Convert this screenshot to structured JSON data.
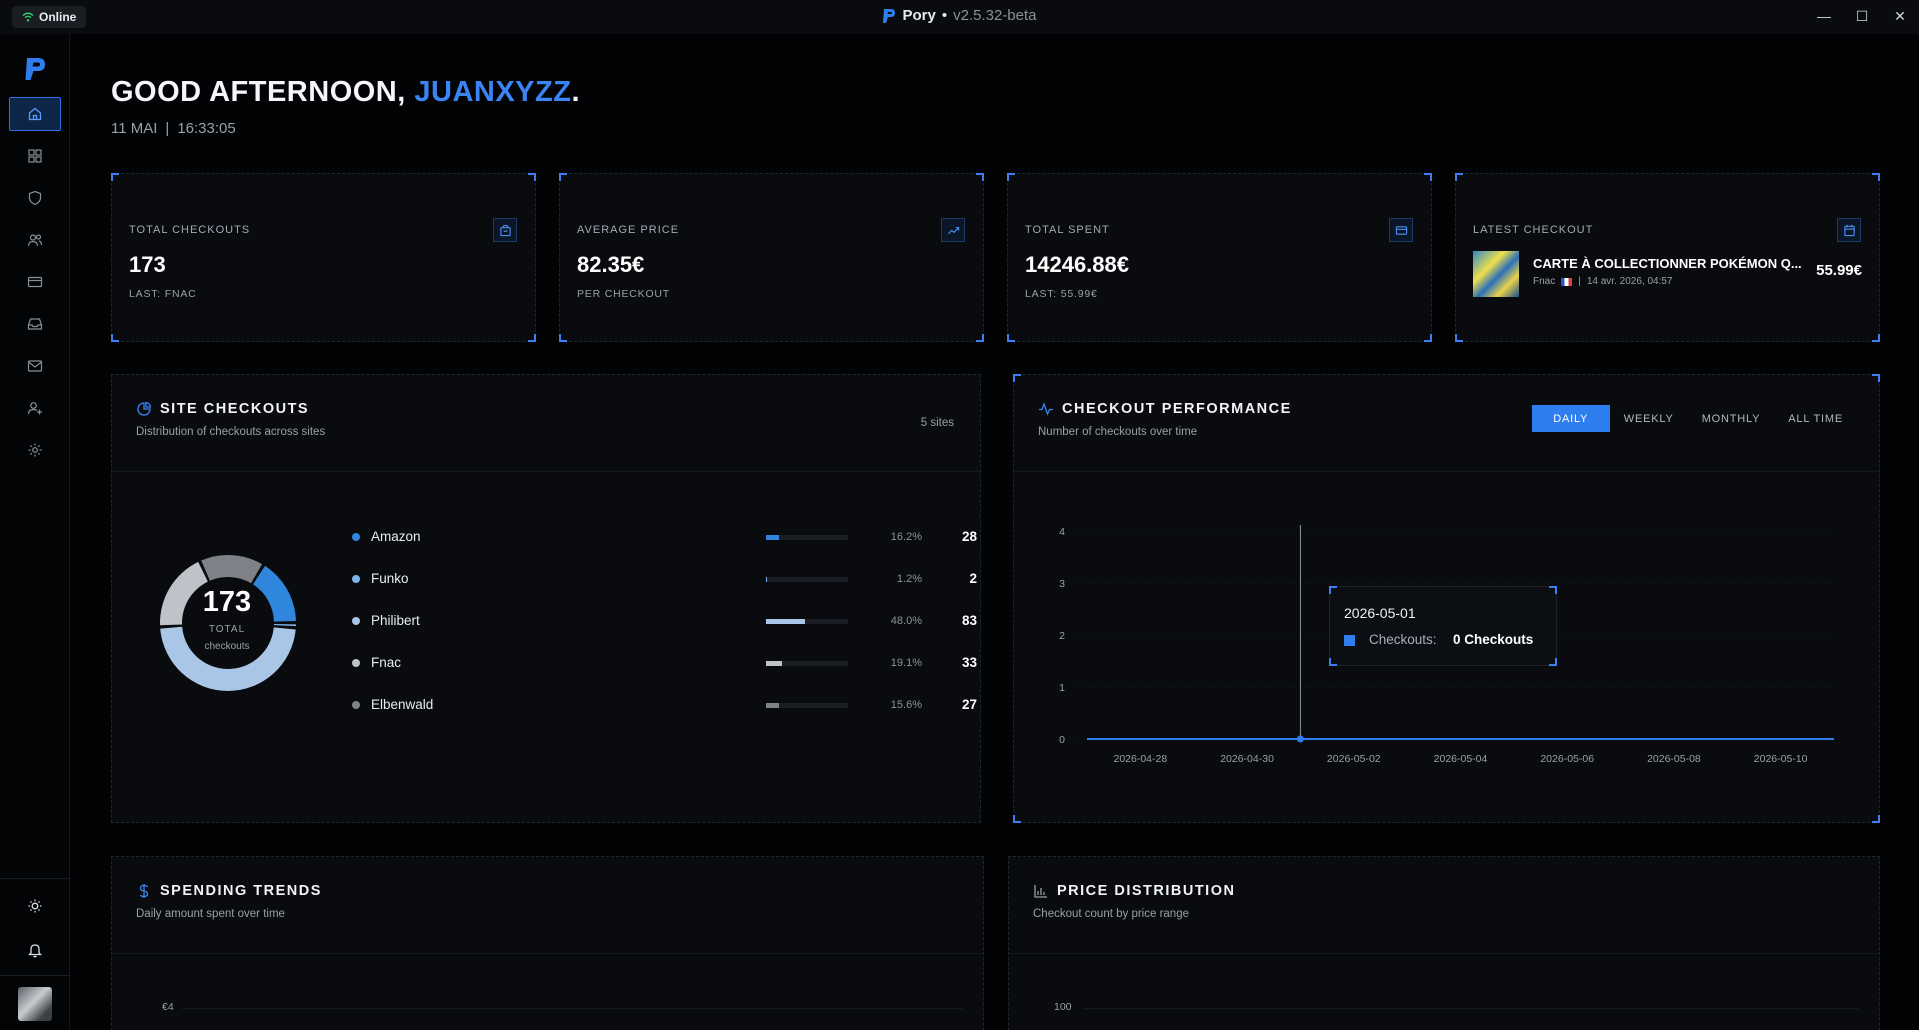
{
  "titlebar": {
    "status": "Online",
    "app_name": "Pory",
    "bullet": "•",
    "version": "v2.5.32-beta",
    "controls": [
      "—",
      "☐",
      "✕"
    ]
  },
  "sidebar": {
    "items": [
      {
        "icon": "home-icon",
        "active": true
      },
      {
        "icon": "grid-icon",
        "active": false
      },
      {
        "icon": "shield-icon",
        "active": false
      },
      {
        "icon": "users-icon",
        "active": false
      },
      {
        "icon": "card-icon",
        "active": false
      },
      {
        "icon": "inbox-icon",
        "active": false
      },
      {
        "icon": "mail-icon",
        "active": false
      },
      {
        "icon": "user-plus-icon",
        "active": false
      },
      {
        "icon": "gear-icon",
        "active": false
      }
    ],
    "bottom": [
      "sun-icon",
      "bell-icon"
    ]
  },
  "header": {
    "greeting": "GOOD AFTERNOON, ",
    "username": "JUANXYZZ",
    "period": ".",
    "date": "11 MAI",
    "sep": "|",
    "time": "16:33:05"
  },
  "stats": {
    "total_checkouts": {
      "label": "TOTAL CHECKOUTS",
      "value": "173",
      "sub": "LAST: FNAC"
    },
    "average_price": {
      "label": "AVERAGE PRICE",
      "value": "82.35€",
      "sub": "PER CHECKOUT"
    },
    "total_spent": {
      "label": "TOTAL SPENT",
      "value": "14246.88€",
      "sub": "LAST: 55.99€"
    },
    "latest": {
      "label": "LATEST CHECKOUT",
      "title": "CARTE À COLLECTIONNER POKÉMON Q...",
      "site": "Fnac",
      "sep": "|",
      "date": "14 avr. 2026, 04:57",
      "price": "55.99€"
    }
  },
  "site_checkouts": {
    "title": "SITE CHECKOUTS",
    "subtitle": "Distribution of checkouts across sites",
    "count_note": "5 sites",
    "total": "173",
    "total_label": "TOTAL",
    "total_sub": "checkouts",
    "sites": [
      {
        "name": "Amazon",
        "pct_label": "16.2%",
        "pct": 16.2,
        "count": "28",
        "color": "#2f86dc"
      },
      {
        "name": "Funko",
        "pct_label": "1.2%",
        "pct": 1.2,
        "count": "2",
        "color": "#7db4ee"
      },
      {
        "name": "Philibert",
        "pct_label": "48.0%",
        "pct": 48.0,
        "count": "83",
        "color": "#a9c6e6"
      },
      {
        "name": "Fnac",
        "pct_label": "19.1%",
        "pct": 19.1,
        "count": "33",
        "color": "#bfc3c9"
      },
      {
        "name": "Elbenwald",
        "pct_label": "15.6%",
        "pct": 15.6,
        "count": "27",
        "color": "#7e8288"
      }
    ]
  },
  "performance": {
    "title": "CHECKOUT PERFORMANCE",
    "subtitle": "Number of checkouts over time",
    "tabs": [
      "DAILY",
      "WEEKLY",
      "MONTHLY",
      "ALL TIME"
    ],
    "active_tab": "DAILY",
    "tooltip": {
      "date": "2026-05-01",
      "key": "Checkouts:",
      "value": "0 Checkouts"
    }
  },
  "chart_data": {
    "type": "line",
    "x": [
      "2026-04-27",
      "2026-04-28",
      "2026-04-29",
      "2026-04-30",
      "2026-05-01",
      "2026-05-02",
      "2026-05-03",
      "2026-05-04",
      "2026-05-05",
      "2026-05-06",
      "2026-05-07",
      "2026-05-08",
      "2026-05-09",
      "2026-05-10",
      "2026-05-11"
    ],
    "xticks": [
      "2026-04-28",
      "2026-04-30",
      "2026-05-02",
      "2026-05-04",
      "2026-05-06",
      "2026-05-08",
      "2026-05-10"
    ],
    "series": [
      {
        "values": [
          0,
          0,
          0,
          0,
          0,
          0,
          0,
          0,
          0,
          0,
          0,
          0,
          0,
          0,
          0
        ]
      }
    ],
    "yticks": [
      0,
      1,
      2,
      3,
      4
    ],
    "ylim": [
      0,
      4
    ],
    "highlight_x": "2026-05-01",
    "color": "#2f7ef0"
  },
  "spending": {
    "title": "SPENDING TRENDS",
    "subtitle": "Daily amount spent over time",
    "first_tick": "€4"
  },
  "price_distribution": {
    "title": "PRICE DISTRIBUTION",
    "subtitle": "Checkout count by price range",
    "first_tick": "100"
  }
}
